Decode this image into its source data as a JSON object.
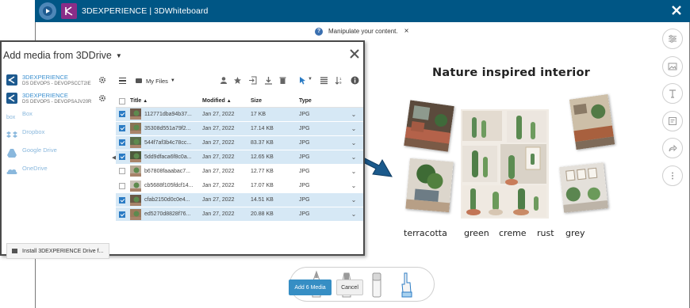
{
  "app": {
    "title": "3DEXPERIENCE | 3DWhiteboard"
  },
  "hint": {
    "text": "Manipulate your content.",
    "close": "×"
  },
  "right_toolbar": {
    "icons": [
      "sliders-icon",
      "image-icon",
      "text-icon",
      "note-icon",
      "share-icon",
      "more-icon"
    ]
  },
  "board": {
    "title": "Nature inspired interior",
    "captions": [
      "terracotta",
      "green",
      "creme",
      "rust",
      "grey"
    ]
  },
  "dialog": {
    "title": "Add media from 3DDrive",
    "sources": [
      {
        "label": "3DEXPERIENCE",
        "sub": "DS DEVOPS - DEVOPSCCT2IE"
      },
      {
        "label": "3DEXPERIENCE",
        "sub": "DS DEVOPS - DEVOPSAJV20R"
      },
      {
        "label": "Box"
      },
      {
        "label": "Dropbox"
      },
      {
        "label": "Google Drive"
      },
      {
        "label": "OneDrive"
      }
    ],
    "install_label": "Install 3DEXPERIENCE Drive f...",
    "location": "My Files",
    "columns": {
      "title": "Title",
      "modified": "Modified",
      "size": "Size",
      "type": "Type"
    },
    "files": [
      {
        "name": "112771dba94b37...",
        "modified": "Jan 27, 2022",
        "size": "17 KB",
        "type": "JPG",
        "selected": true
      },
      {
        "name": "35308d551a79f2...",
        "modified": "Jan 27, 2022",
        "size": "17.14 KB",
        "type": "JPG",
        "selected": true
      },
      {
        "name": "544f7af3b4c78cc...",
        "modified": "Jan 27, 2022",
        "size": "83.37 KB",
        "type": "JPG",
        "selected": true
      },
      {
        "name": "5dd9dfaca6f8c0a...",
        "modified": "Jan 27, 2022",
        "size": "12.65 KB",
        "type": "JPG",
        "selected": true
      },
      {
        "name": "b67808faaabac7...",
        "modified": "Jan 27, 2022",
        "size": "12.77 KB",
        "type": "JPG",
        "selected": false
      },
      {
        "name": "cb5688f105fdcf14...",
        "modified": "Jan 27, 2022",
        "size": "17.07 KB",
        "type": "JPG",
        "selected": false
      },
      {
        "name": "cfab2150d0c0e4...",
        "modified": "Jan 27, 2022",
        "size": "14.51 KB",
        "type": "JPG",
        "selected": true
      },
      {
        "name": "ed5270d8828f76...",
        "modified": "Jan 27, 2022",
        "size": "20.88 KB",
        "type": "JPG",
        "selected": true
      }
    ],
    "add_label": "Add 6 Media",
    "cancel_label": "Cancel"
  },
  "colors": {
    "header": "#005685",
    "accent": "#368ec4",
    "selected_row": "#d6e8f5",
    "badge": "#8a2d88"
  }
}
